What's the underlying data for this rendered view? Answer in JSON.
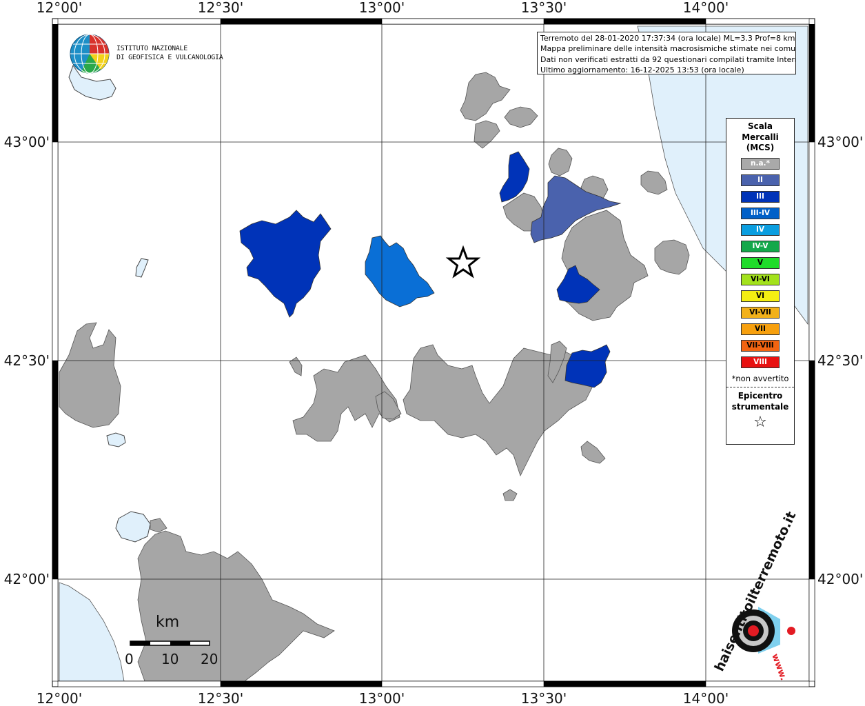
{
  "map": {
    "lon_labels": [
      "12°00'",
      "12°30'",
      "13°00'",
      "13°30'",
      "14°00'"
    ],
    "lat_labels": [
      "43°00'",
      "42°30'",
      "42°00'"
    ],
    "info_lines": [
      "Terremoto del 28-01-2020 17:37:34 (ora locale) ML=3.3 Prof=8 km",
      "Mappa preliminare delle intensità macrosismiche stimate nei comuni",
      "Dati non verificati estratti da 92 questionari compilati tramite Internet.",
      "Ultimo aggiornamento: 16-12-2025 13:53 (ora locale)"
    ],
    "ingv_line1": "ISTITUTO NAZIONALE",
    "ingv_line2": "DI GEOFISICA E VULCANOLOGIA",
    "site_text": "haisentitoilterremoto.it",
    "site_prefix": "www.",
    "colors": {
      "land_na": "#a6a6a6",
      "water": "#e0f0fb",
      "int_II": "#4a62ad",
      "int_III": "#0033b8",
      "int_IV": "#0a6fd6"
    }
  },
  "legend": {
    "title_lines": [
      "Scala",
      "Mercalli",
      "(MCS)"
    ],
    "items": [
      {
        "label": "n.a.*",
        "color": "#a9a9a9",
        "text_color": "#ffffff"
      },
      {
        "label": "II",
        "color": "#4a62ad",
        "text_color": "#ffffff"
      },
      {
        "label": "III",
        "color": "#0033b8",
        "text_color": "#ffffff"
      },
      {
        "label": "III-IV",
        "color": "#0060c8",
        "text_color": "#ffffff"
      },
      {
        "label": "IV",
        "color": "#0a9ee0",
        "text_color": "#ffffff"
      },
      {
        "label": "IV-V",
        "color": "#13a84a",
        "text_color": "#ffffff"
      },
      {
        "label": "V",
        "color": "#1fdc2a",
        "text_color": "#000000"
      },
      {
        "label": "VI-VI",
        "color": "#a3e21c",
        "text_color": "#000000"
      },
      {
        "label": "VI",
        "color": "#f4ee12",
        "text_color": "#000000"
      },
      {
        "label": "VI-VII",
        "color": "#f2b11a",
        "text_color": "#000000"
      },
      {
        "label": "VII",
        "color": "#f7a00e",
        "text_color": "#000000"
      },
      {
        "label": "VII-VIII",
        "color": "#f26411",
        "text_color": "#000000"
      },
      {
        "label": "VIII",
        "color": "#e81111",
        "text_color": "#ffffff"
      }
    ],
    "note": "*non avvertito",
    "epicenter_lines": [
      "Epicentro",
      "strumentale"
    ],
    "epicenter_symbol": "☆"
  },
  "scale_bar": {
    "unit": "km",
    "ticks": [
      "0",
      "10",
      "20"
    ]
  }
}
